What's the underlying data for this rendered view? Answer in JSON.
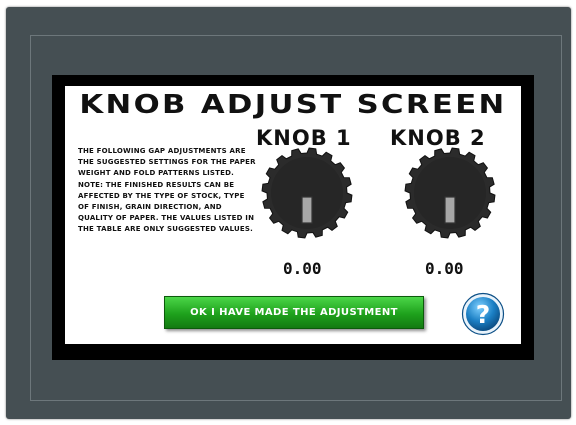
{
  "screen": {
    "title": "KNOB ADJUST SCREEN",
    "description": "The following gap adjustments are the suggested settings for the paper weight and fold patterns listed. Note: The finished results can be affected by the type of stock, type of finish, grain direction, and quality of paper. The values listed in the table are only suggested values."
  },
  "knobs": [
    {
      "label": "KNOB 1",
      "value": "0.00",
      "icon": "knob-dial-icon"
    },
    {
      "label": "KNOB 2",
      "value": "0.00",
      "icon": "knob-dial-icon"
    }
  ],
  "actions": {
    "ok_label": "OK I HAVE MADE THE ADJUSTMENT",
    "help_icon": "question-mark-icon",
    "help_glyph": "?"
  },
  "colors": {
    "bezel": "#454f53",
    "ok_button": "#1ea11c",
    "help_button": "#1b7fc4"
  }
}
